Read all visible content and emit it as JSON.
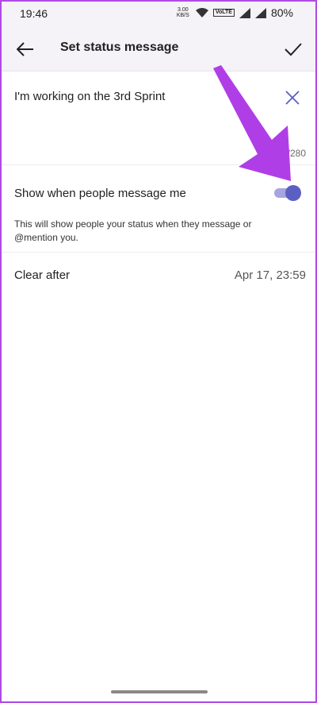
{
  "status_bar": {
    "time": "19:46",
    "net_speed_value": "3.00",
    "net_speed_unit": "KB/S",
    "network_type": "VoLTE",
    "battery": "80%"
  },
  "app_bar": {
    "title": "Set status message"
  },
  "message": {
    "text": "I'm working on the 3rd Sprint",
    "char_count": "0/280"
  },
  "show_when_messaged": {
    "label": "Show when people message me",
    "enabled": true,
    "description": "This will show people your status when they message or @mention you."
  },
  "clear_after": {
    "label": "Clear after",
    "value": "Apr 17, 23:59"
  },
  "colors": {
    "accent": "#5c5fc2",
    "annotation_arrow": "#b03ee6"
  },
  "icons": [
    "back-arrow-icon",
    "check-icon",
    "close-icon",
    "wifi-icon",
    "signal-icon"
  ]
}
